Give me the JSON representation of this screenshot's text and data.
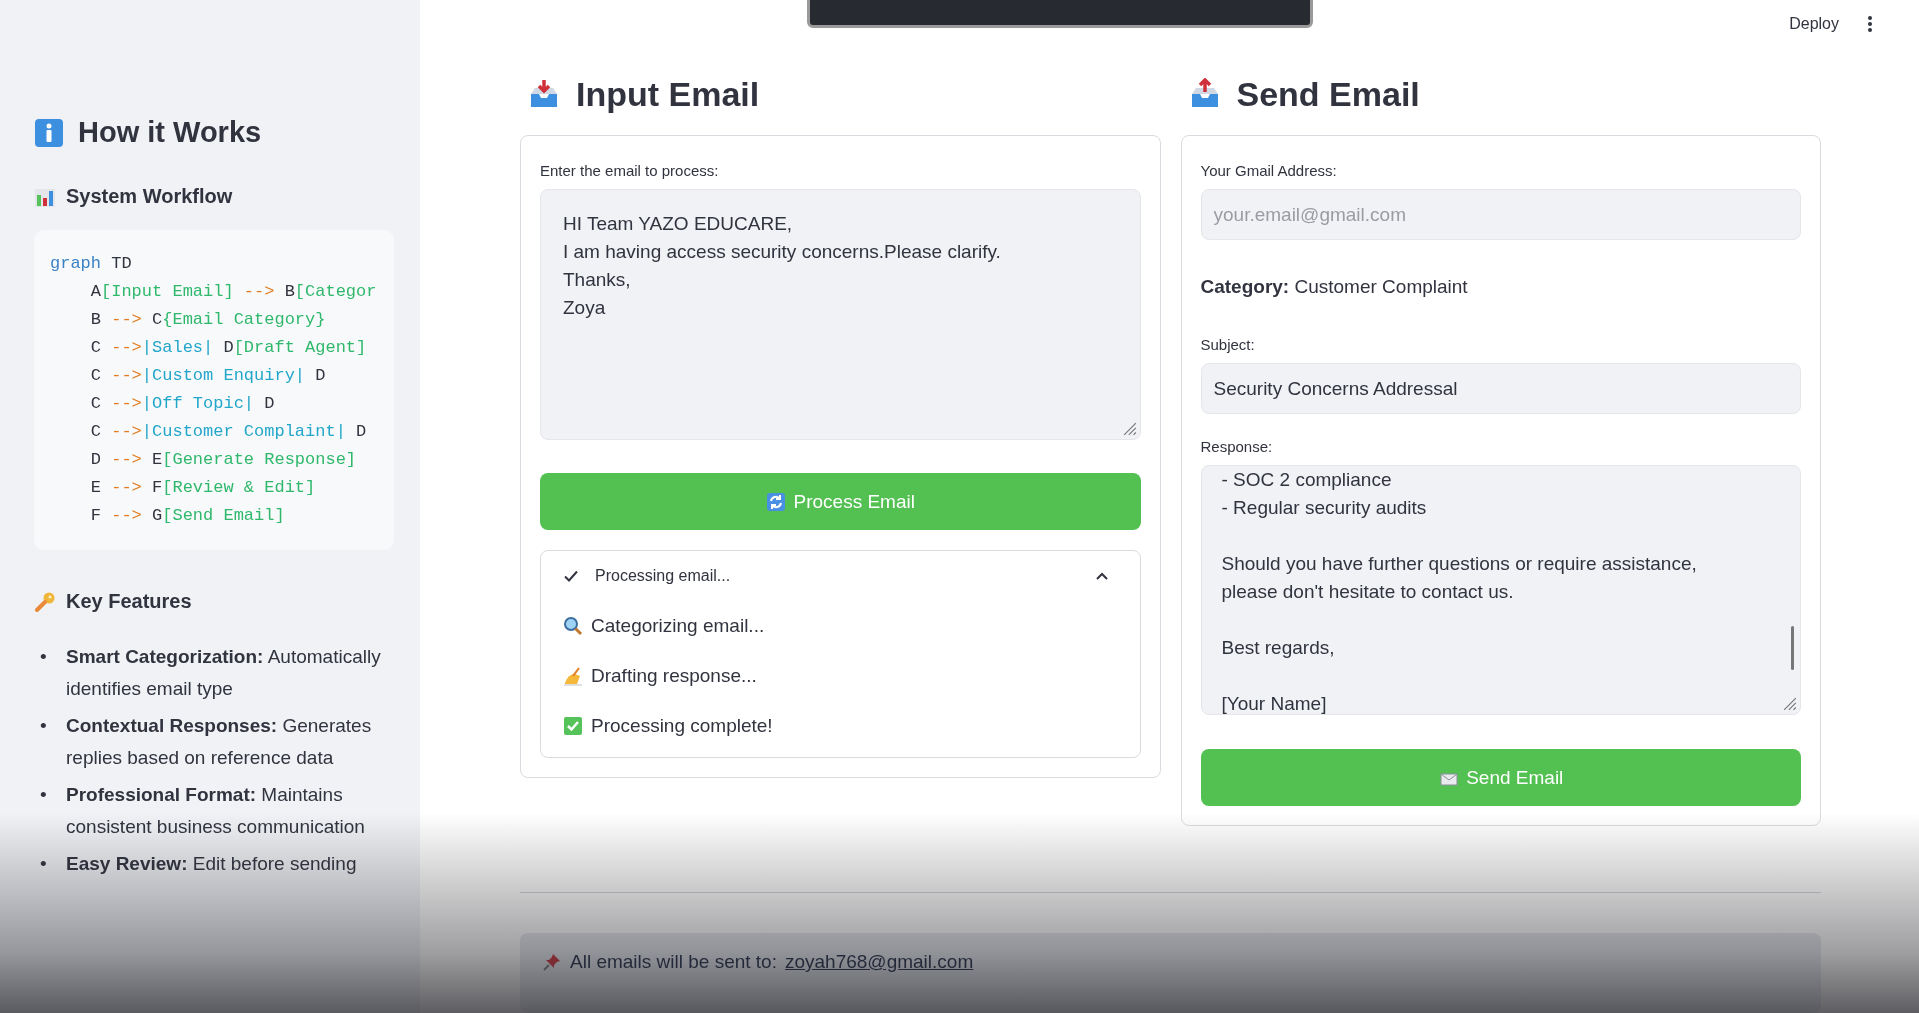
{
  "header": {
    "deploy": "Deploy"
  },
  "sidebar": {
    "title": "How it Works",
    "workflow_title": "System Workflow",
    "workflow_code": [
      [
        {
          "kind": "keyword",
          "text": "graph"
        },
        {
          "kind": "plain",
          "text": " TD"
        }
      ],
      [
        {
          "kind": "plain",
          "text": "    A"
        },
        {
          "kind": "node",
          "text": "[Input Email]"
        },
        {
          "kind": "arrow",
          "text": " --> "
        },
        {
          "kind": "plain",
          "text": "B"
        },
        {
          "kind": "node",
          "text": "[Categor"
        }
      ],
      [
        {
          "kind": "plain",
          "text": "    B"
        },
        {
          "kind": "arrow",
          "text": " --> "
        },
        {
          "kind": "plain",
          "text": "C"
        },
        {
          "kind": "node",
          "text": "{Email Category}"
        }
      ],
      [
        {
          "kind": "plain",
          "text": "    C"
        },
        {
          "kind": "arrow",
          "text": " -->"
        },
        {
          "kind": "label",
          "text": "|Sales|"
        },
        {
          "kind": "plain",
          "text": " D"
        },
        {
          "kind": "node",
          "text": "[Draft Agent]"
        }
      ],
      [
        {
          "kind": "plain",
          "text": "    C"
        },
        {
          "kind": "arrow",
          "text": " -->"
        },
        {
          "kind": "label",
          "text": "|Custom Enquiry|"
        },
        {
          "kind": "plain",
          "text": " D"
        }
      ],
      [
        {
          "kind": "plain",
          "text": "    C"
        },
        {
          "kind": "arrow",
          "text": " -->"
        },
        {
          "kind": "label",
          "text": "|Off Topic|"
        },
        {
          "kind": "plain",
          "text": " D"
        }
      ],
      [
        {
          "kind": "plain",
          "text": "    C"
        },
        {
          "kind": "arrow",
          "text": " -->"
        },
        {
          "kind": "label",
          "text": "|Customer Complaint|"
        },
        {
          "kind": "plain",
          "text": " D"
        }
      ],
      [
        {
          "kind": "plain",
          "text": "    D"
        },
        {
          "kind": "arrow",
          "text": " --> "
        },
        {
          "kind": "plain",
          "text": "E"
        },
        {
          "kind": "node",
          "text": "[Generate Response]"
        }
      ],
      [
        {
          "kind": "plain",
          "text": "    E"
        },
        {
          "kind": "arrow",
          "text": " --> "
        },
        {
          "kind": "plain",
          "text": "F"
        },
        {
          "kind": "node",
          "text": "[Review & Edit]"
        }
      ],
      [
        {
          "kind": "plain",
          "text": "    F"
        },
        {
          "kind": "arrow",
          "text": " --> "
        },
        {
          "kind": "plain",
          "text": "G"
        },
        {
          "kind": "node",
          "text": "[Send Email]"
        }
      ]
    ],
    "features_title": "Key Features",
    "features": [
      {
        "marker": "•",
        "name": "Smart Categorization:",
        "description": "Automatically identifies email type"
      },
      {
        "marker": "•",
        "name": "Contextual Responses:",
        "description": "Generates replies based on reference data"
      },
      {
        "marker": "•",
        "name": "Professional Format:",
        "description": "Maintains consistent business communication"
      },
      {
        "marker": "•",
        "name": "Easy Review:",
        "description": "Edit before sending"
      }
    ]
  },
  "input_panel": {
    "title": "Input Email",
    "email_label": "Enter the email to process:",
    "email_value": "HI Team YAZO EDUCARE,\nI am having access security concerns.Please clarify.\nThanks,\nZoya",
    "process_button": "Process Email",
    "status": {
      "title": "Processing email...",
      "expanded": true,
      "steps": [
        {
          "kind": "search",
          "text": "Categorizing email..."
        },
        {
          "kind": "writing",
          "text": "Drafting response..."
        },
        {
          "kind": "done",
          "text": "Processing complete!"
        }
      ]
    }
  },
  "send_panel": {
    "title": "Send Email",
    "gmail_label": "Your Gmail Address:",
    "gmail_placeholder": "your.email@gmail.com",
    "category_label": "Category:",
    "category_value": "Customer Complaint",
    "subject_label": "Subject:",
    "subject_value": "Security Concerns Addressal",
    "response_label": "Response:",
    "response_value": "- SOC 2 compliance\n- Regular security audits\n\nShould you have further questions or require assistance, please don't hesitate to contact us.\n\nBest regards,\n\n[Your Name]",
    "send_button": "Send Email"
  },
  "footer_note": {
    "text": "All emails will be sent to:",
    "link": "zoyah768@gmail.com"
  }
}
